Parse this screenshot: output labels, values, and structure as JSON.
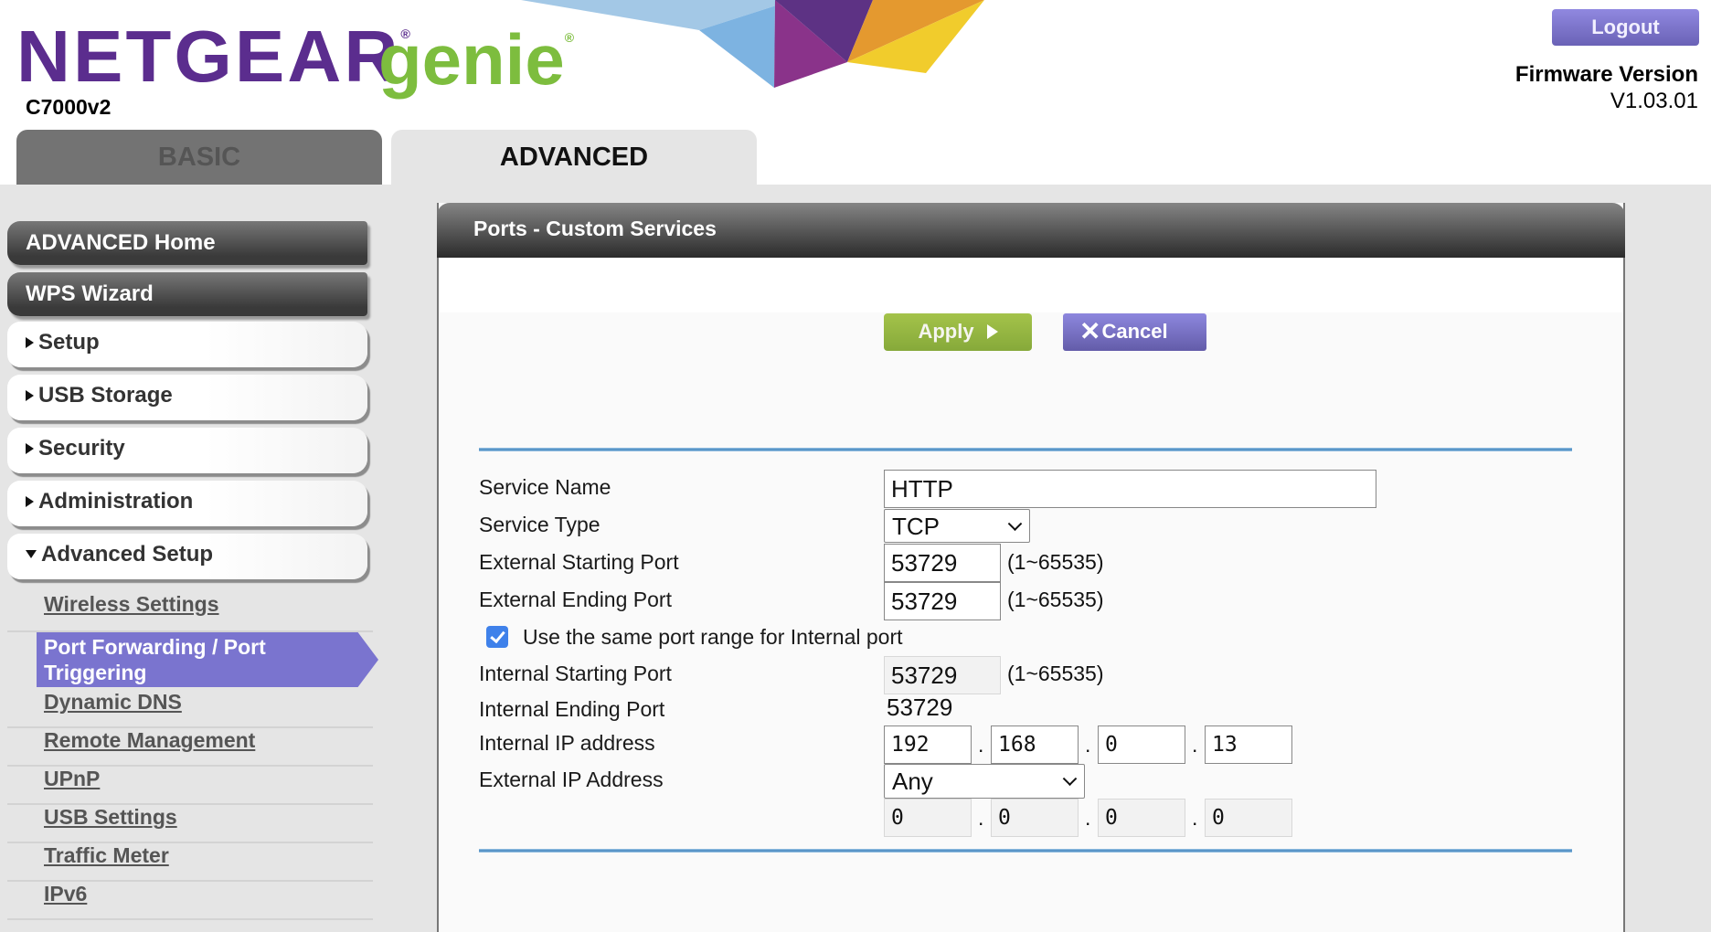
{
  "header": {
    "brand": "NETGEAR",
    "brand_reg": "®",
    "product": "genie",
    "product_reg": "®",
    "model": "C7000v2",
    "logout_label": "Logout",
    "firmware_label": "Firmware Version",
    "firmware_version": "V1.03.01",
    "banner_colors": [
      "#a3c8e6",
      "#7db3e1",
      "#5d3284",
      "#8a338a",
      "#e4992f",
      "#f1cc2c"
    ]
  },
  "tabs": [
    {
      "label": "BASIC",
      "active": false
    },
    {
      "label": "ADVANCED",
      "active": true
    }
  ],
  "sidebar": {
    "primary": [
      {
        "label": "ADVANCED Home"
      },
      {
        "label": "WPS Wizard"
      }
    ],
    "sections": [
      {
        "label": "Setup",
        "expanded": false
      },
      {
        "label": "USB Storage",
        "expanded": false
      },
      {
        "label": "Security",
        "expanded": false
      },
      {
        "label": "Administration",
        "expanded": false
      },
      {
        "label": "Advanced Setup",
        "expanded": true
      }
    ],
    "sub_items": [
      {
        "label": "Wireless Settings",
        "active": false
      },
      {
        "label": "Port Forwarding / Port Triggering",
        "label_line1": "Port Forwarding / Port",
        "label_line2": "Triggering",
        "active": true
      },
      {
        "label": "Dynamic DNS",
        "active": false
      },
      {
        "label": "Remote Management",
        "active": false
      },
      {
        "label": "UPnP",
        "active": false
      },
      {
        "label": "USB Settings",
        "active": false
      },
      {
        "label": "Traffic Meter",
        "active": false
      },
      {
        "label": "IPv6",
        "active": false
      }
    ]
  },
  "panel": {
    "title": "Ports - Custom Services",
    "apply_label": "Apply",
    "cancel_label": "Cancel",
    "form": {
      "service_name_label": "Service Name",
      "service_name_value": "HTTP",
      "service_type_label": "Service Type",
      "service_type_value": "TCP",
      "ext_start_label": "External Starting Port",
      "ext_start_value": "53729",
      "ext_end_label": "External Ending Port",
      "ext_end_value": "53729",
      "range_hint": "(1~65535)",
      "same_range_label": "Use the same port range for Internal port",
      "same_range_checked": true,
      "int_start_label": "Internal Starting Port",
      "int_start_value": "53729",
      "int_end_label": "Internal Ending Port",
      "int_end_value": "53729",
      "int_ip_label": "Internal IP address",
      "int_ip": [
        "192",
        "168",
        "0",
        "13"
      ],
      "ext_ip_label": "External IP Address",
      "ext_ip_mode": "Any",
      "ext_ip": [
        "0",
        "0",
        "0",
        "0"
      ],
      "ip_separator": "."
    }
  }
}
